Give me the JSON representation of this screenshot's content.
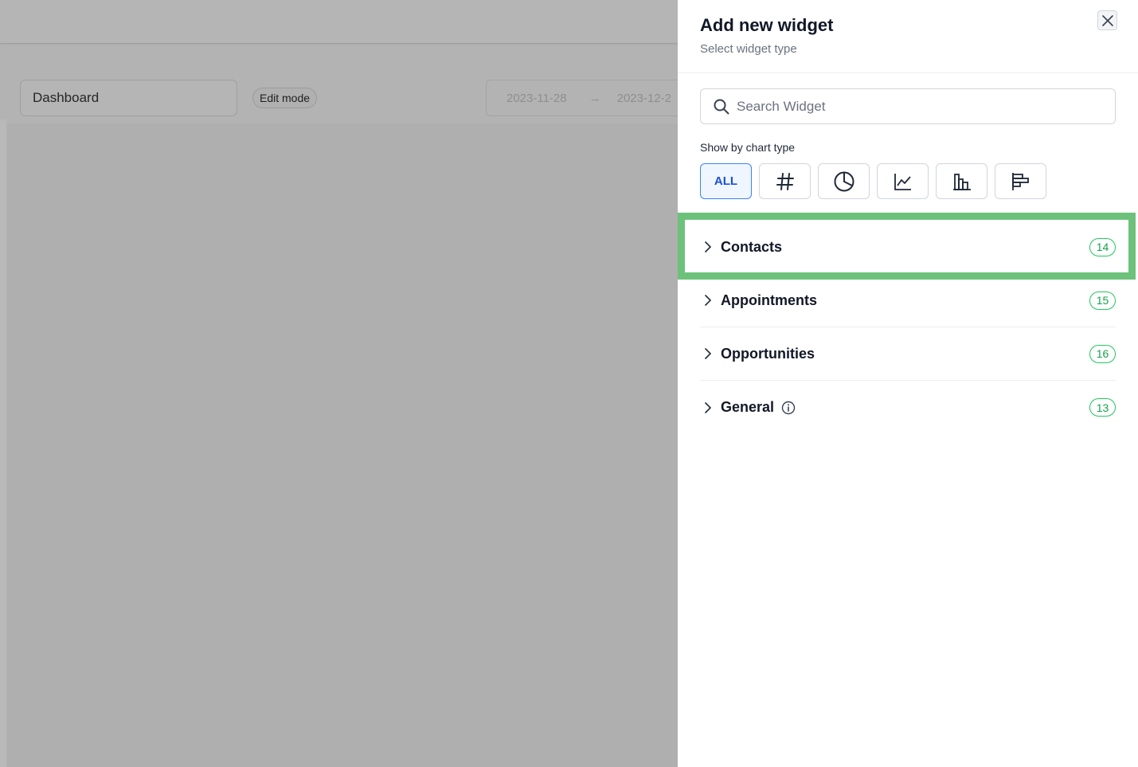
{
  "background": {
    "dashboard_select": "Dashboard",
    "edit_mode_label": "Edit mode",
    "date_start": "2023-11-28",
    "date_arrow": "→",
    "date_end": "2023-12-2"
  },
  "drawer": {
    "title": "Add new widget",
    "subtitle": "Select widget type",
    "close_icon": "close-icon",
    "search": {
      "placeholder": "Search Widget",
      "value": "",
      "icon": "search-icon"
    },
    "chart_type_label": "Show by chart type",
    "chart_types": [
      {
        "label": "ALL",
        "active": true
      },
      {
        "icon": "hash-icon"
      },
      {
        "icon": "pie-chart-icon"
      },
      {
        "icon": "line-chart-icon"
      },
      {
        "icon": "bar-chart-icon"
      },
      {
        "icon": "horizontal-bar-chart-icon"
      }
    ],
    "categories": [
      {
        "label": "Contacts",
        "count": "14",
        "highlighted": true
      },
      {
        "label": "Appointments",
        "count": "15"
      },
      {
        "label": "Opportunities",
        "count": "16"
      },
      {
        "label": "General",
        "count": "13",
        "info_icon": true
      }
    ]
  },
  "colors": {
    "accent_blue": "#1d4ed8",
    "badge_green": "#16a34a",
    "highlight_green": "#6cc27a",
    "overlay_gray": "#b3b3b3"
  }
}
